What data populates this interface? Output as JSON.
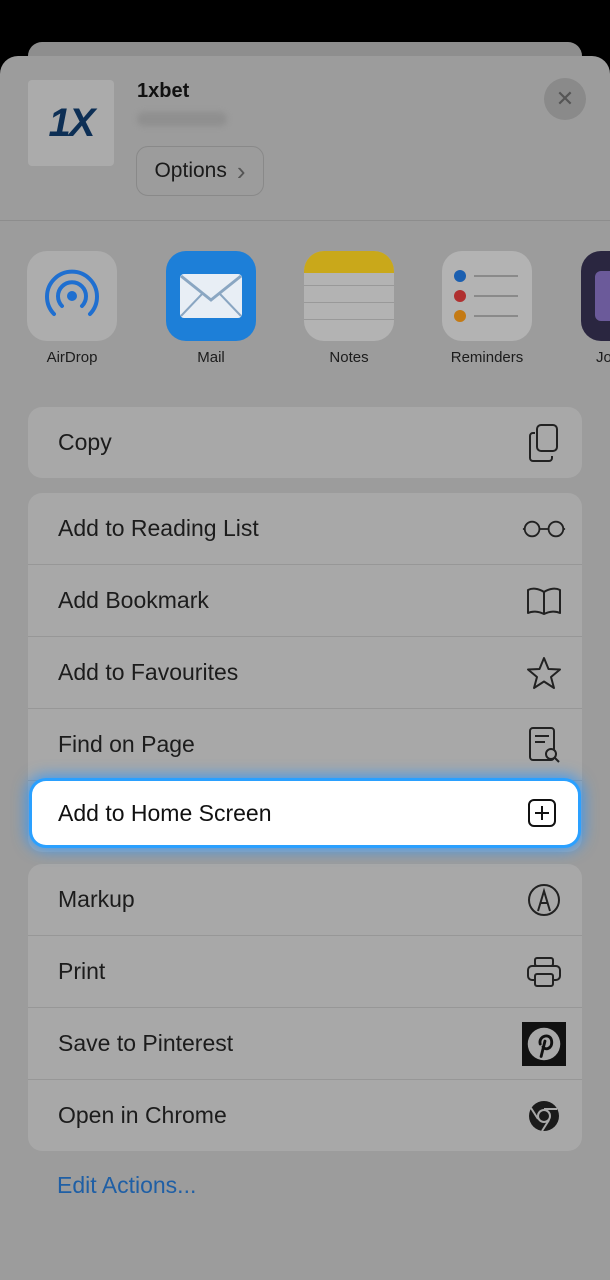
{
  "header": {
    "app_name": "1xbet",
    "logo_text": "1X",
    "options_label": "Options",
    "chevron_right": "›",
    "close_glyph": "✕"
  },
  "apps": [
    {
      "label": "AirDrop",
      "icon": "airdrop-icon"
    },
    {
      "label": "Mail",
      "icon": "mail-icon"
    },
    {
      "label": "Notes",
      "icon": "notes-icon"
    },
    {
      "label": "Reminders",
      "icon": "reminders-icon"
    },
    {
      "label": "Jo",
      "icon": "app-icon"
    }
  ],
  "actions": {
    "copy": "Copy",
    "add_reading_list": "Add to Reading List",
    "add_bookmark": "Add Bookmark",
    "add_favourites": "Add to Favourites",
    "find_on_page": "Find on Page",
    "add_home_screen": "Add to Home Screen",
    "markup": "Markup",
    "print": "Print",
    "save_pinterest": "Save to Pinterest",
    "open_chrome": "Open in Chrome"
  },
  "edit_actions": "Edit Actions...",
  "colors": {
    "highlight_glow": "#2aa0ff",
    "link": "#1f5fa5",
    "mail_blue": "#1d8cf0",
    "notes_yellow": "#f5c913"
  }
}
